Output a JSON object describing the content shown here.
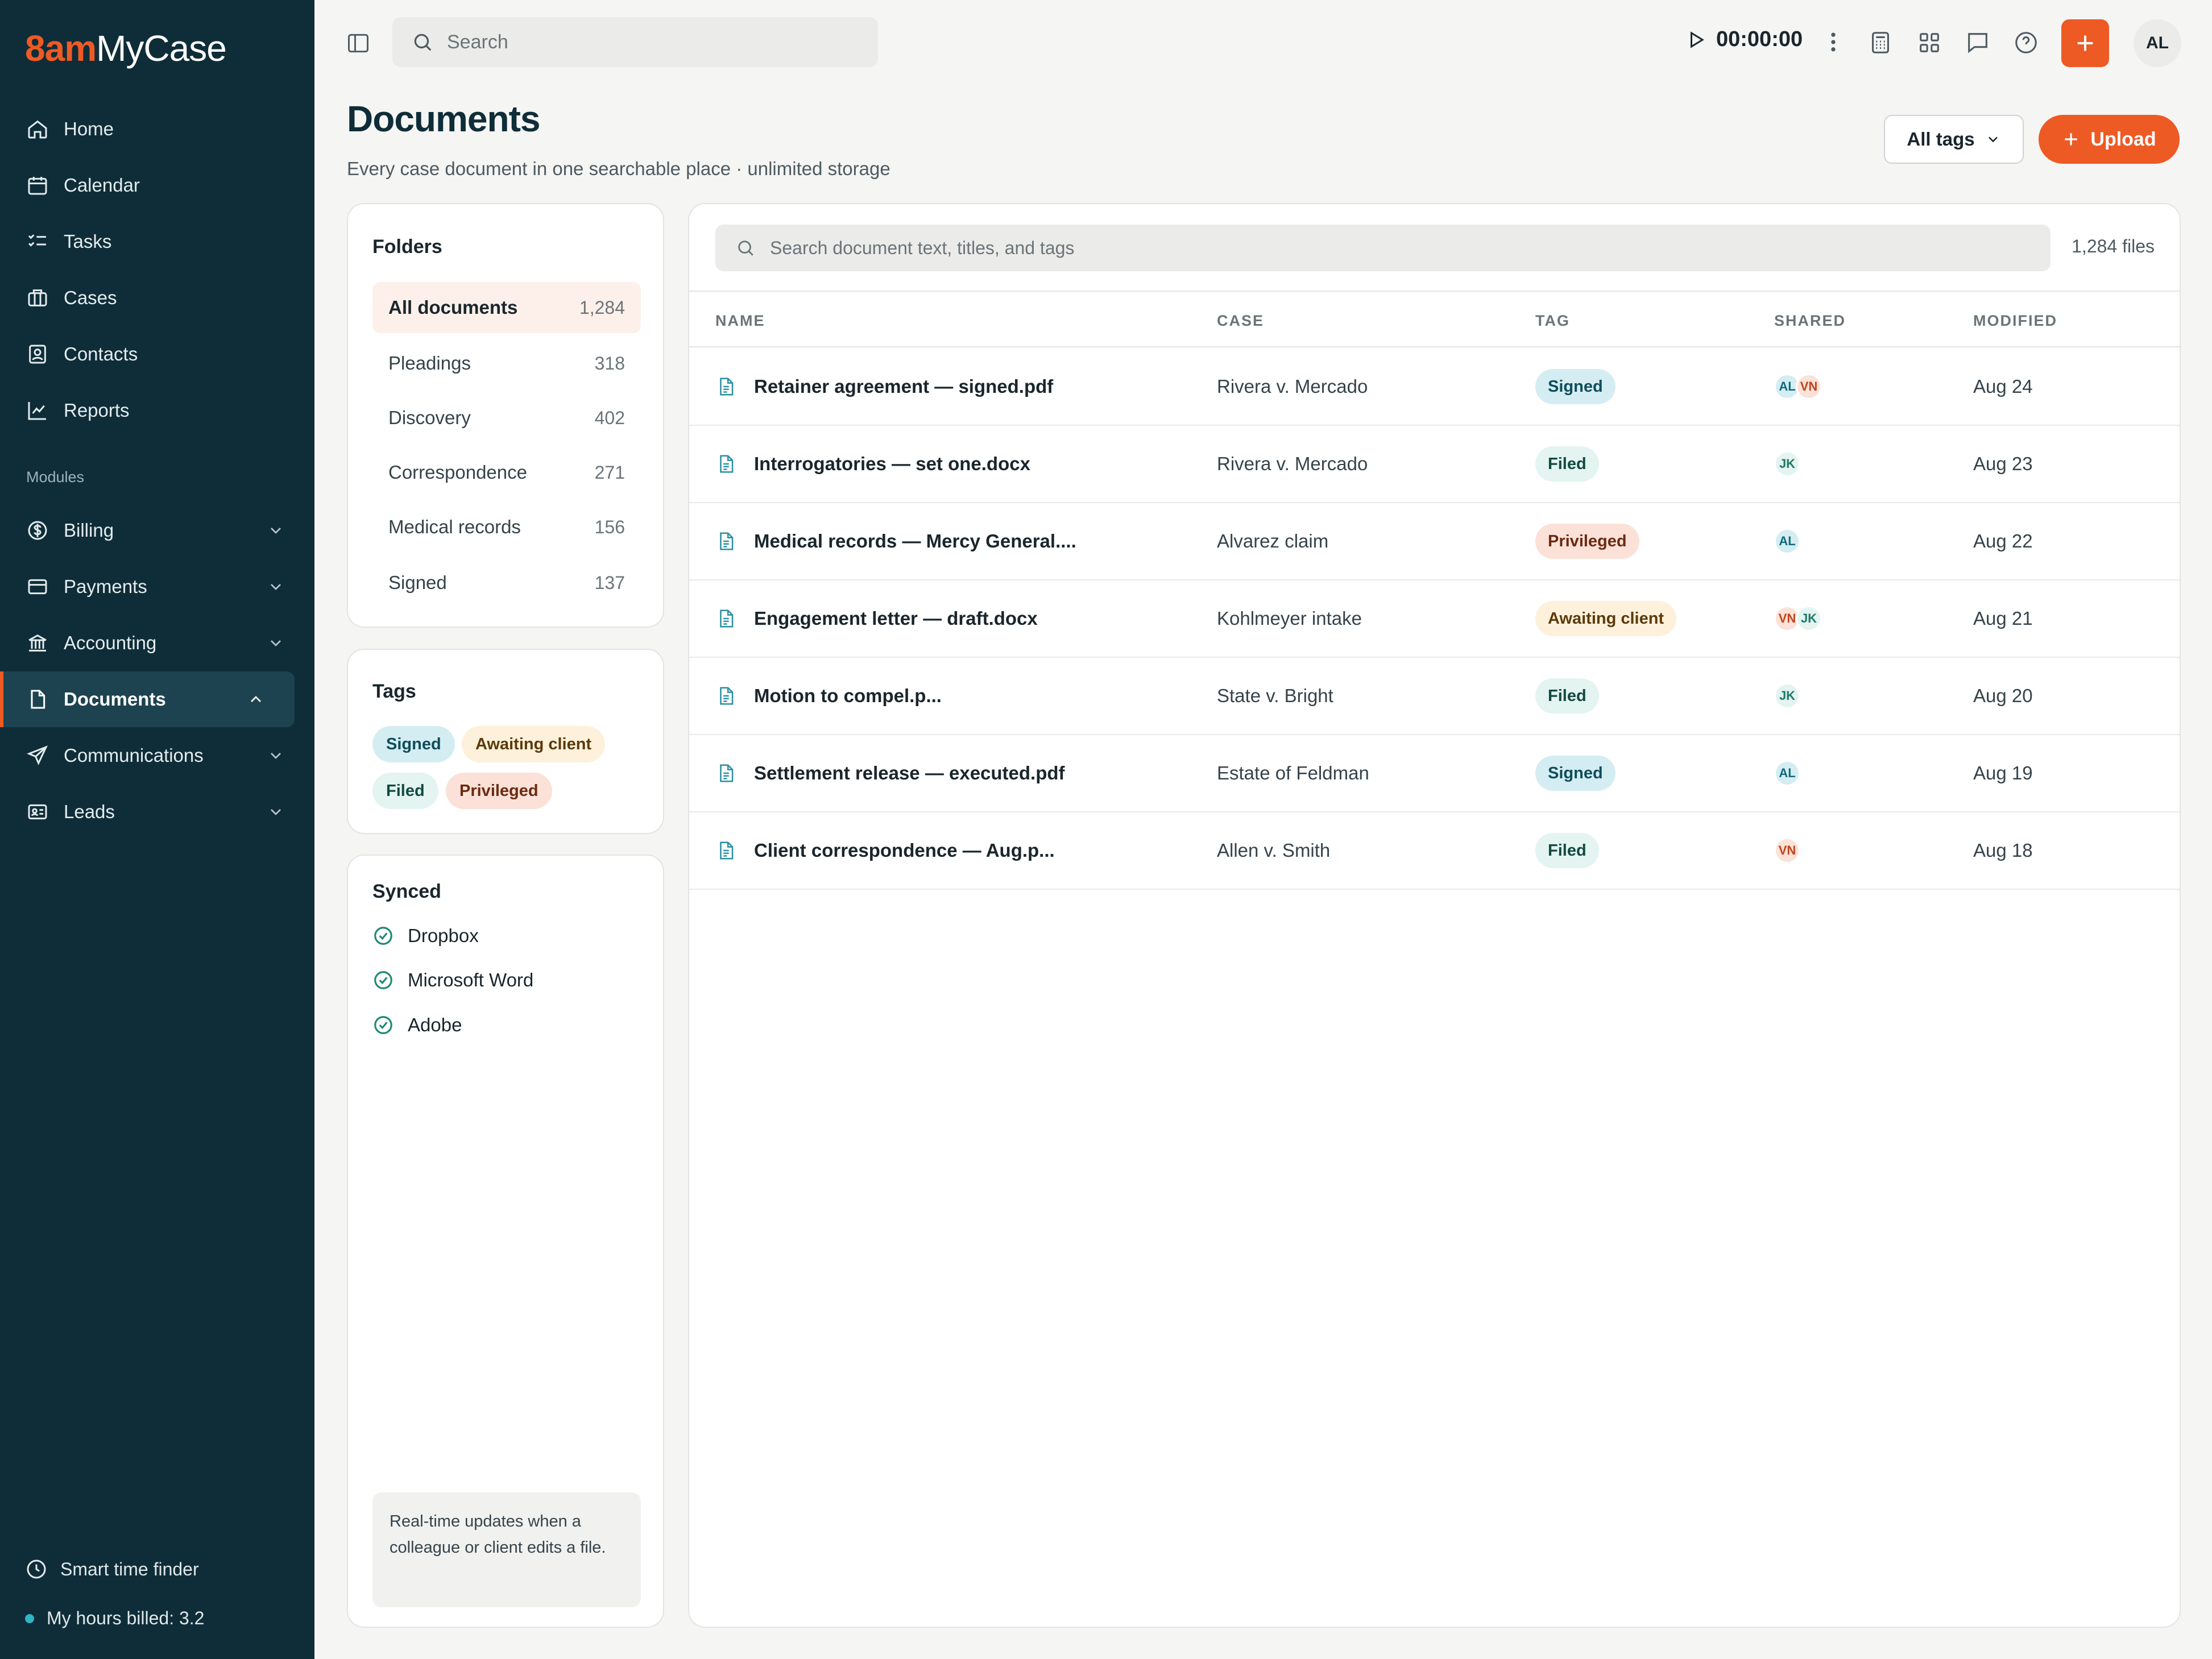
{
  "brand": {
    "prefix": "8am",
    "name": "MyCase"
  },
  "nav": {
    "main": [
      {
        "label": "Home",
        "icon": "home-icon"
      },
      {
        "label": "Calendar",
        "icon": "calendar-icon"
      },
      {
        "label": "Tasks",
        "icon": "tasks-icon"
      },
      {
        "label": "Cases",
        "icon": "briefcase-icon"
      },
      {
        "label": "Contacts",
        "icon": "contacts-icon"
      },
      {
        "label": "Reports",
        "icon": "chart-icon"
      }
    ],
    "modules_label": "Modules",
    "modules": [
      {
        "label": "Billing",
        "icon": "dollar-icon"
      },
      {
        "label": "Payments",
        "icon": "card-icon"
      },
      {
        "label": "Accounting",
        "icon": "bank-icon"
      },
      {
        "label": "Documents",
        "icon": "document-icon",
        "active": true
      },
      {
        "label": "Communications",
        "icon": "send-icon"
      },
      {
        "label": "Leads",
        "icon": "id-card-icon"
      }
    ],
    "footer": {
      "smart_time": "Smart time finder",
      "hours_billed": "My hours billed: 3.2"
    }
  },
  "topbar": {
    "search_placeholder": "Search",
    "timer": "00:00:00",
    "avatar": "AL"
  },
  "page": {
    "title": "Documents",
    "subtitle": "Every case document in one searchable place · unlimited storage",
    "tags_button": "All tags",
    "upload_button": "Upload"
  },
  "folders": {
    "title": "Folders",
    "items": [
      {
        "label": "All documents",
        "count": "1,284",
        "selected": true
      },
      {
        "label": "Pleadings",
        "count": "318"
      },
      {
        "label": "Discovery",
        "count": "402"
      },
      {
        "label": "Correspondence",
        "count": "271"
      },
      {
        "label": "Medical records",
        "count": "156"
      },
      {
        "label": "Signed",
        "count": "137"
      }
    ]
  },
  "tags": {
    "title": "Tags",
    "items": [
      "Signed",
      "Awaiting client",
      "Filed",
      "Privileged"
    ]
  },
  "synced": {
    "title": "Synced",
    "items": [
      "Dropbox",
      "Microsoft Word",
      "Adobe"
    ],
    "note": "Real-time updates when a colleague or client edits a file."
  },
  "documents": {
    "search_placeholder": "Search document text, titles, and tags",
    "file_count": "1,284 files",
    "columns": {
      "name": "NAME",
      "case": "CASE",
      "tag": "TAG",
      "shared": "SHARED",
      "modified": "MODIFIED"
    },
    "rows": [
      {
        "name": "Retainer agreement — signed.pdf",
        "case": "Rivera v. Mercado",
        "tag": "Signed",
        "shared": [
          "AL",
          "VN"
        ],
        "modified": "Aug 24"
      },
      {
        "name": "Interrogatories — set one.docx",
        "case": "Rivera v. Mercado",
        "tag": "Filed",
        "shared": [
          "JK"
        ],
        "modified": "Aug 23"
      },
      {
        "name": "Medical records — Mercy General....",
        "case": "Alvarez claim",
        "tag": "Privileged",
        "shared": [
          "AL"
        ],
        "modified": "Aug 22"
      },
      {
        "name": "Engagement letter — draft.docx",
        "case": "Kohlmeyer intake",
        "tag": "Awaiting client",
        "shared": [
          "VN",
          "JK"
        ],
        "modified": "Aug 21"
      },
      {
        "name": "Motion to compel.p...",
        "case": "State v. Bright",
        "tag": "Filed",
        "shared": [
          "JK"
        ],
        "modified": "Aug 20"
      },
      {
        "name": "Settlement release — executed.pdf",
        "case": "Estate of Feldman",
        "tag": "Signed",
        "shared": [
          "AL"
        ],
        "modified": "Aug 19"
      },
      {
        "name": "Client correspondence — Aug.p...",
        "case": "Allen v. Smith",
        "tag": "Filed",
        "shared": [
          "VN"
        ],
        "modified": "Aug 18"
      }
    ]
  },
  "colors": {
    "sidebar": "#0f2d38",
    "accent": "#ee5a24",
    "tag_signed": "#d4edf2",
    "tag_filed": "#e3f4f1",
    "tag_privileged": "#fbe1d7",
    "tag_awaiting": "#fdf1dc"
  }
}
